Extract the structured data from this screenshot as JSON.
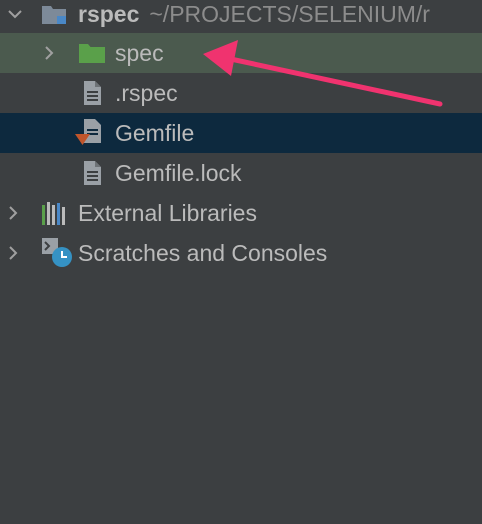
{
  "tree": {
    "root": {
      "name": "rspec",
      "path": "~/PROJECTS/SELENIUM/r"
    },
    "items": [
      {
        "label": "spec",
        "icon": "folder-icon"
      },
      {
        "label": ".rspec",
        "icon": "file-icon"
      },
      {
        "label": "Gemfile",
        "icon": "gemfile-icon"
      },
      {
        "label": "Gemfile.lock",
        "icon": "file-icon"
      }
    ],
    "external_libraries": {
      "label": "External Libraries",
      "icon": "libraries-icon"
    },
    "scratches": {
      "label": "Scratches and Consoles",
      "icon": "scratches-icon"
    }
  },
  "colors": {
    "background": "#3c3f41",
    "highlight_row": "#4b5a4e",
    "selected_row": "#0d293e",
    "folder": "#5aa04a",
    "annotation_arrow": "#f0336f"
  }
}
